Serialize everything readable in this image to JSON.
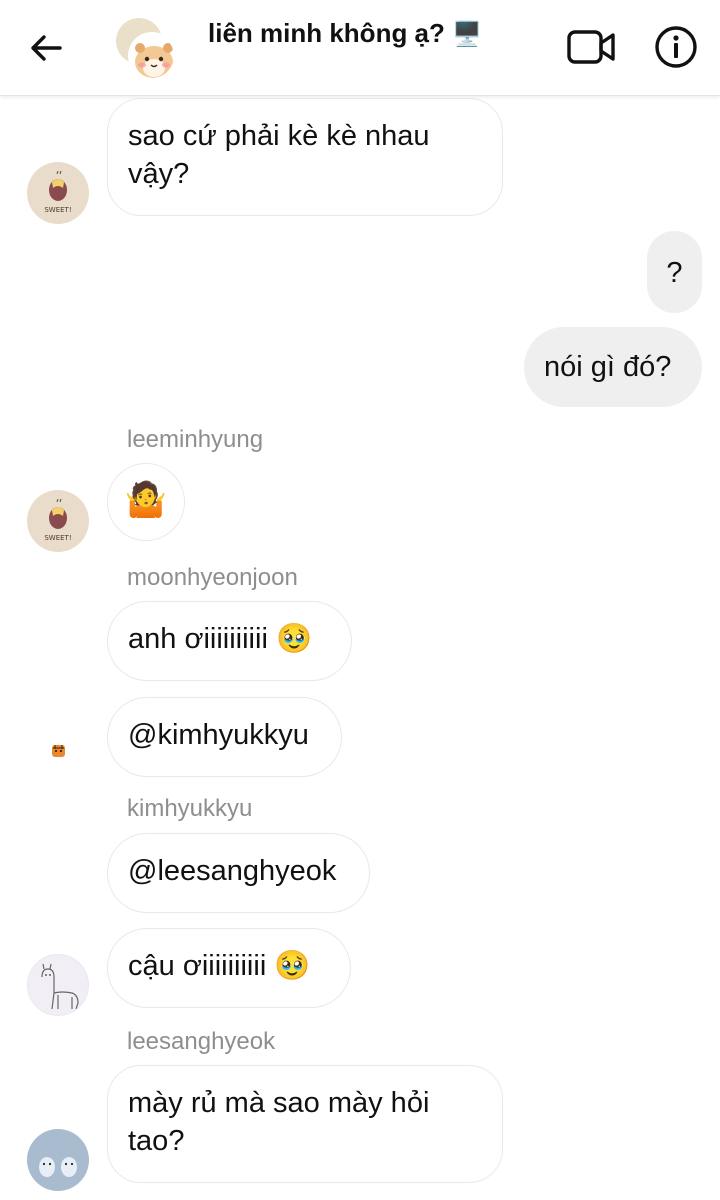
{
  "header": {
    "title": "liên minh không ạ?",
    "title_emoji": "🖥️"
  },
  "messages": [
    {
      "text_line1": "sao cứ phải kè kè nhau",
      "text_line2": "vậy?"
    },
    {
      "text": "?"
    },
    {
      "text": "nói gì đó?"
    },
    {
      "sender": "leeminhyung",
      "text": "🤷"
    },
    {
      "sender": "moonhyeonjoon",
      "text": "anh ơiiiiiiiiii 🥹"
    },
    {
      "text": "@kimhyukkyu"
    },
    {
      "sender": "kimhyukkyu",
      "text": "@leesanghyeok"
    },
    {
      "text": "cậu ơiiiiiiiiii 🥹"
    },
    {
      "sender": "leesanghyeok",
      "text_line1": "mày rủ mà sao mày hỏi",
      "text_line2": "tao?"
    }
  ],
  "avatar_labels": {
    "potato": "SWEET!"
  },
  "colors": {
    "bubble_mine": "#efefef",
    "bubble_border": "#e8e8e8",
    "sender_label": "#8e8e8e"
  }
}
